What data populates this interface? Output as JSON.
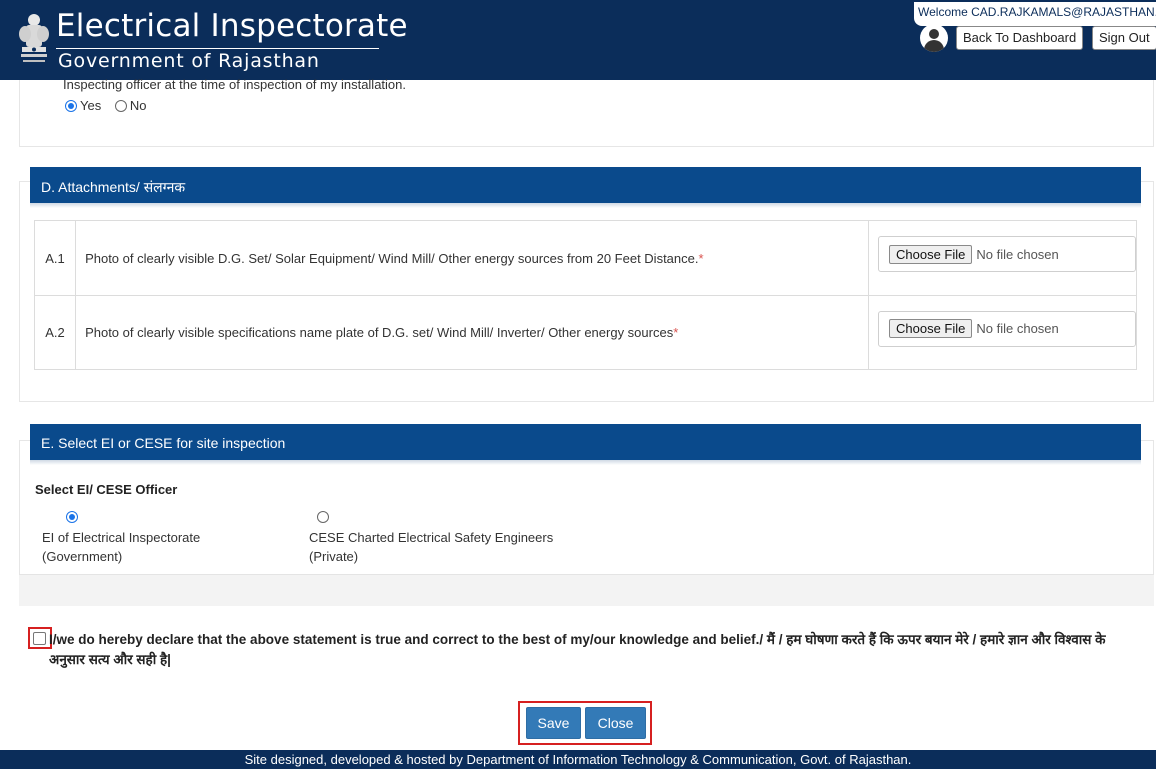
{
  "header": {
    "title": "Electrical Inspectorate",
    "subtitle": "Government of Rajasthan",
    "welcome": "Welcome CAD.RAJKAMALS@RAJASTHAN....",
    "back_button": "Back To Dashboard",
    "signout_button": "Sign Out",
    "bg_color": "#0b2d5a"
  },
  "section_c": {
    "question_tail": "Inspecting officer at the time of inspection of my installation.",
    "options": [
      {
        "label": "Yes",
        "checked": true
      },
      {
        "label": "No",
        "checked": false
      }
    ]
  },
  "section_d": {
    "title": "D. Attachments/ संलग्नक",
    "rows": [
      {
        "num": "A.1",
        "desc": "Photo of clearly visible D.G. Set/ Solar Equipment/ Wind Mill/ Other energy sources from 20 Feet Distance.",
        "required": "*",
        "choose": "Choose File",
        "status": "No file chosen"
      },
      {
        "num": "A.2",
        "desc": "Photo of clearly visible specifications name plate of D.G. set/ Wind Mill/ Inverter/ Other energy sources",
        "required": "*",
        "choose": "Choose File",
        "status": "No file chosen"
      }
    ]
  },
  "section_e": {
    "title": "E. Select EI or CESE for site inspection",
    "select_label": "Select EI/ CESE Officer",
    "options": [
      {
        "line1": "EI of Electrical Inspectorate",
        "line2": "(Government)",
        "checked": true
      },
      {
        "line1": "CESE Charted Electrical Safety Engineers",
        "line2": "(Private)",
        "checked": false
      }
    ]
  },
  "declaration": {
    "text": "I/we do hereby declare that the above statement is true and correct to the best of my/our knowledge and belief./ मैं / हम घोषणा करते हैं कि ऊपर बयान मेरे / हमारे ज्ञान और विश्वास के अनुसार सत्य और सही है|",
    "checked": false
  },
  "actions": {
    "save": "Save",
    "close": "Close",
    "color": "#337ab7"
  },
  "footer": {
    "text": "Site designed, developed & hosted by Department of Information Technology & Communication, Govt. of Rajasthan."
  }
}
